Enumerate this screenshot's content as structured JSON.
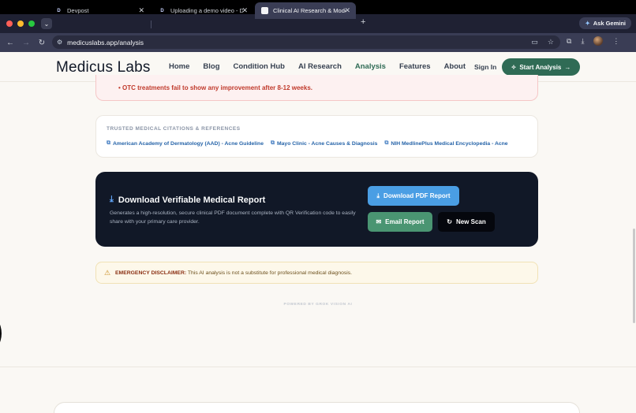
{
  "browser": {
    "tabs": [
      {
        "title": "Devpost",
        "favicon": "D"
      },
      {
        "title": "Uploading a demo video - De",
        "favicon": "D"
      },
      {
        "title": "Clinical AI Research & Model",
        "favicon": ""
      }
    ],
    "ask_gemini": "Ask Gemini",
    "url": "medicuslabs.app/analysis"
  },
  "header": {
    "logo": "Medicus Labs",
    "nav": [
      "Home",
      "Blog",
      "Condition Hub",
      "AI Research",
      "Analysis",
      "Features",
      "About"
    ],
    "active_nav": "Analysis",
    "sign_in": "Sign In",
    "start_button": "Start Analysis"
  },
  "criteria": {
    "bullet": "OTC treatments fail to show any improvement after 8-12 weeks."
  },
  "citations": {
    "title": "TRUSTED MEDICAL CITATIONS & REFERENCES",
    "links": [
      "American Academy of Dermatology (AAD) - Acne Guideline",
      "Mayo Clinic - Acne Causes & Diagnosis",
      "NIH MedlinePlus Medical Encyclopedia - Acne"
    ]
  },
  "report": {
    "title": "Download Verifiable Medical Report",
    "description": "Generates a high-resolution, secure clinical PDF document complete with QR Verification code to easily share with your primary care provider.",
    "download_pdf": "Download PDF Report",
    "email_report": "Email Report",
    "new_scan": "New Scan"
  },
  "disclaimer": {
    "label": "EMERGENCY DISCLAIMER:",
    "text": " This AI analysis is not a substitute for professional medical diagnosis."
  },
  "footer_note": "POWERED BY GROK VISION AI",
  "colors": {
    "brand_green": "#2f6b55",
    "report_bg": "#111827",
    "pdf_button": "#4a9ee4",
    "email_button": "#4a9572",
    "warning_red": "#c0392b"
  }
}
